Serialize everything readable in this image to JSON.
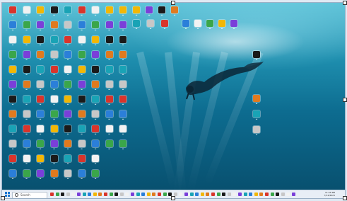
{
  "window": {
    "resize_handles": 6
  },
  "taskbar": {
    "search_label": "Search",
    "clock_time": "11:55 PM",
    "clock_date": "7/12/2021",
    "pinned_count": 46
  },
  "colors": {
    "accent": "#1876d1",
    "water_top": "#5fc4d9",
    "water_bottom": "#08506f",
    "taskbar": "#e8eef6"
  },
  "desktop": {
    "icon_columns": 9,
    "icon_rows": 12,
    "extra_clusters": 3
  }
}
